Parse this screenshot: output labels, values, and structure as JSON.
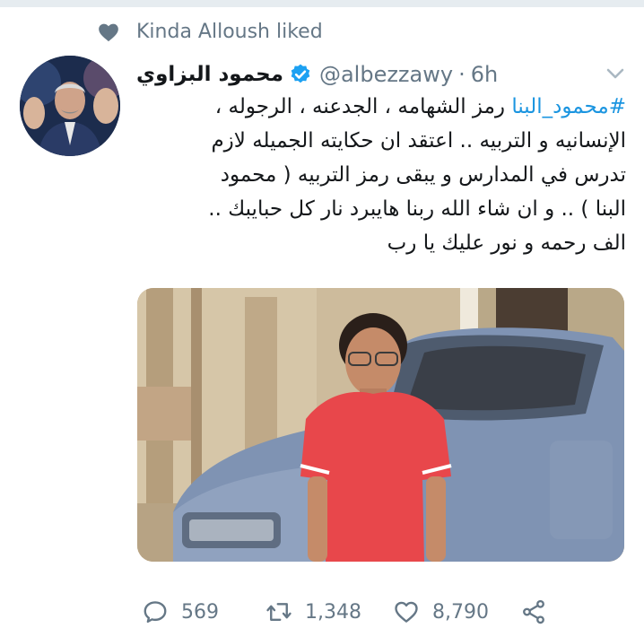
{
  "colors": {
    "text": "#14171a",
    "secondary": "#657786",
    "link": "#1b95e0",
    "verified": "#1da1f2"
  },
  "social_context": {
    "icon": "heart-icon",
    "text": "Kinda Alloush liked"
  },
  "tweet": {
    "author_name": "محمود البزاوي",
    "verified": true,
    "handle": "@albezzawy",
    "separator": "·",
    "time": "6h",
    "text": {
      "hashtag": "#محمود_البنا",
      "line1_rest": " رمز الشهامه ، الجدعنه ، الرجوله ،",
      "line2": "الإنسانيه و التربيه .. اعتقد ان حكايته الجميله لازم",
      "line3": "تدرس في المدارس و يبقى رمز التربيه ( محمود",
      "line4": "البنا ) .. و ان شاء الله ربنا هايبرد نار كل حبايبك ..",
      "line5": "الف رحمه و نور عليك يا رب"
    },
    "actions": {
      "reply_count": "569",
      "retweet_count": "1,348",
      "like_count": "8,790"
    }
  }
}
